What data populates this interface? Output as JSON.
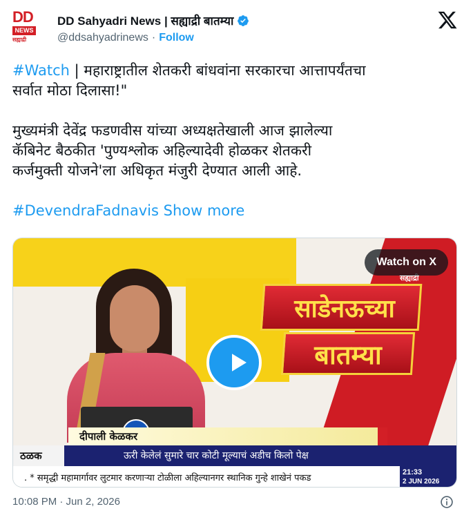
{
  "account": {
    "logo_top": "DD",
    "logo_mid": "NEWS",
    "logo_bottom": "सह्याद्री",
    "display_name": "DD Sahyadri News | सह्याद्री बातम्या",
    "handle": "@ddsahyadrinews",
    "separator": "·",
    "follow_label": "Follow"
  },
  "tweet": {
    "hashtag1": "#Watch",
    "line1_rest": " | महाराष्ट्रातील शेतकरी बांधवांना सरकारचा आत्तापर्यंतचा",
    "line2": "सर्वात मोठा दिलासा!\"",
    "para2_line1": "मुख्यमंत्री देवेंद्र फडणवीस यांच्या अध्यक्षतेखाली आज झालेल्या",
    "para2_line2": "कॅबिनेट बैठकीत 'पुण्यश्लोक अहिल्यादेवी होळकर शेतकरी",
    "para2_line3": "कर्जमुक्ती योजने'ला अधिकृत मंजुरी देण्यात आली आहे.",
    "hashtag2": "#DevendraFadnavis",
    "show_more": "Show more"
  },
  "media": {
    "watch_on_x": "Watch on X",
    "corner_brand": "सह्याद्री",
    "title_line1": "साडेनऊच्या",
    "title_line2": "बातम्या",
    "presenter_name": "दीपाली केळकर",
    "ticker_label": "ठळक",
    "ticker_headline": "ऊरी केलेलं सुमारे चार कोटी मूल्याचं अडीच किलो पेक्ष",
    "ticker_crawl": ".  *  समृद्धी महामार्गावर लुटमार करणाऱ्या टोळीला अहिल्यानगर स्थानिक गुन्हे शाखेनं पकड",
    "clock_time": "21:33",
    "clock_date": "2 JUN 2026"
  },
  "footer": {
    "timestamp": "10:08 PM · Jun 2, 2026"
  },
  "colors": {
    "link": "#1d9bf0",
    "muted": "#536471",
    "brand_red": "#d31f26",
    "ticker_blue": "#1b2270"
  },
  "icons": [
    "verified-badge-icon",
    "x-logo-icon",
    "play-icon",
    "info-icon"
  ]
}
